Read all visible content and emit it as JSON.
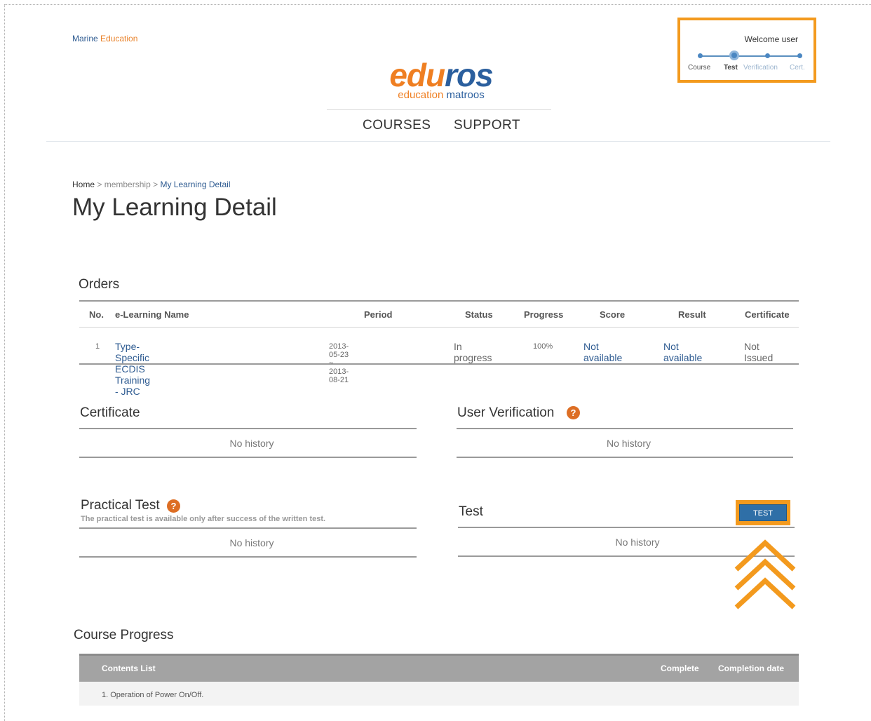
{
  "header": {
    "brand_tag_part1": "Marine",
    "brand_tag_part2": "Education",
    "logo_main_part1": "edu",
    "logo_main_part2": "ros",
    "logo_sub_part1": "education",
    "logo_sub_part2": "matroos",
    "nav": [
      {
        "label": "COURSES"
      },
      {
        "label": "SUPPORT"
      }
    ]
  },
  "user_panel": {
    "welcome": "Welcome user",
    "steps": [
      {
        "label": "Course",
        "active": false
      },
      {
        "label": "Test",
        "active": true
      },
      {
        "label": "Verification",
        "active": false
      },
      {
        "label": "Cert.",
        "active": false
      }
    ]
  },
  "breadcrumb": {
    "home": "Home",
    "separator": ">",
    "middle": "membership",
    "current": "My Learning Detail"
  },
  "page_title": "My Learning Detail",
  "orders": {
    "title": "Orders",
    "columns": [
      "No.",
      "e-Learning Name",
      "Period",
      "Status",
      "Progress",
      "Score",
      "Result",
      "Certificate"
    ],
    "rows": [
      {
        "no": "1",
        "name": "Type-Specific ECDIS Training - JRC",
        "period": "2013-05-23 ~ 2013-08-21",
        "status": "In progress",
        "progress": "100%",
        "score": "Not available",
        "result": "Not available",
        "certificate": "Not Issued"
      }
    ]
  },
  "certificate": {
    "title": "Certificate",
    "empty": "No history"
  },
  "user_verification": {
    "title": "User Verification",
    "empty": "No history",
    "help_glyph": "?"
  },
  "practical_test": {
    "title": "Practical Test",
    "note": "The practical test is available only after success of the written test.",
    "empty": "No history",
    "help_glyph": "?"
  },
  "test": {
    "title": "Test",
    "button_label": "TEST",
    "empty": "No history"
  },
  "course_progress": {
    "title": "Course Progress",
    "columns": [
      "Contents List",
      "Complete",
      "Completion date"
    ],
    "rows": [
      {
        "content": "1. Operation of Power On/Off.",
        "complete": "",
        "date": ""
      }
    ]
  },
  "colors": {
    "accent_orange": "#f39a1e",
    "brand_blue": "#2e5b91",
    "button_blue": "#2f6fa7",
    "help_icon": "#dd6e24"
  },
  "icons": [
    "help-icon",
    "up-chevrons-icon"
  ]
}
